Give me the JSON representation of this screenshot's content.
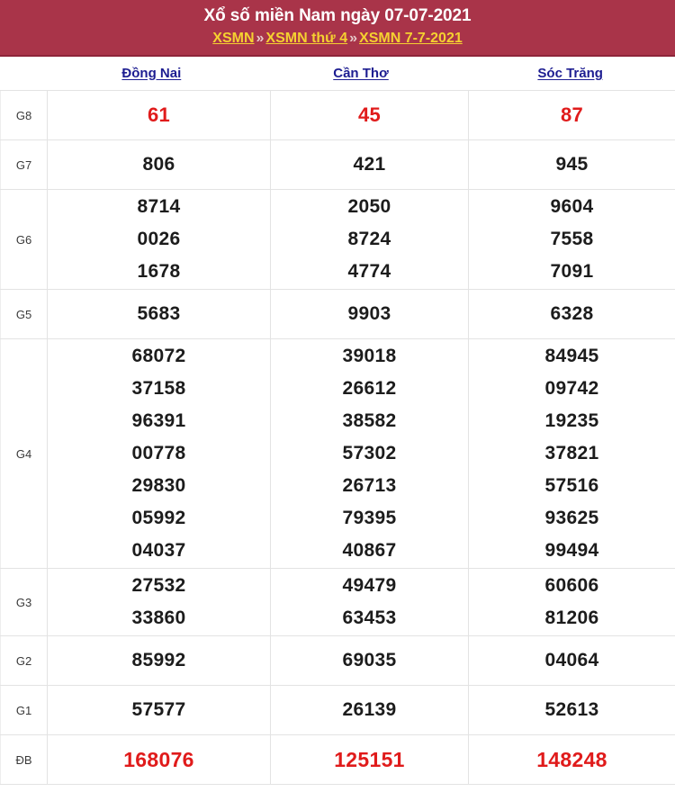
{
  "banner": {
    "title": "Xổ số miền Nam ngày 07-07-2021",
    "breadcrumb": {
      "items": [
        "XSMN",
        "XSMN thứ 4",
        "XSMN 7-7-2021"
      ],
      "separator": "»"
    },
    "bg_color": "#a93449",
    "title_color": "#ffffff",
    "link_color": "#f5d130"
  },
  "table": {
    "provinces": [
      "Đồng Nai",
      "Cần Thơ",
      "Sóc Trăng"
    ],
    "province_link_color": "#1d1d91",
    "highlight_color": "#e01b1b",
    "rows": [
      {
        "prize": "G8",
        "highlight": true,
        "values": [
          [
            "61"
          ],
          [
            "45"
          ],
          [
            "87"
          ]
        ]
      },
      {
        "prize": "G7",
        "highlight": false,
        "values": [
          [
            "806"
          ],
          [
            "421"
          ],
          [
            "945"
          ]
        ]
      },
      {
        "prize": "G6",
        "highlight": false,
        "values": [
          [
            "8714",
            "0026",
            "1678"
          ],
          [
            "2050",
            "8724",
            "4774"
          ],
          [
            "9604",
            "7558",
            "7091"
          ]
        ]
      },
      {
        "prize": "G5",
        "highlight": false,
        "values": [
          [
            "5683"
          ],
          [
            "9903"
          ],
          [
            "6328"
          ]
        ]
      },
      {
        "prize": "G4",
        "highlight": false,
        "values": [
          [
            "68072",
            "37158",
            "96391",
            "00778",
            "29830",
            "05992",
            "04037"
          ],
          [
            "39018",
            "26612",
            "38582",
            "57302",
            "26713",
            "79395",
            "40867"
          ],
          [
            "84945",
            "09742",
            "19235",
            "37821",
            "57516",
            "93625",
            "99494"
          ]
        ]
      },
      {
        "prize": "G3",
        "highlight": false,
        "values": [
          [
            "27532",
            "33860"
          ],
          [
            "49479",
            "63453"
          ],
          [
            "60606",
            "81206"
          ]
        ]
      },
      {
        "prize": "G2",
        "highlight": false,
        "values": [
          [
            "85992"
          ],
          [
            "69035"
          ],
          [
            "04064"
          ]
        ]
      },
      {
        "prize": "G1",
        "highlight": false,
        "values": [
          [
            "57577"
          ],
          [
            "26139"
          ],
          [
            "52613"
          ]
        ]
      },
      {
        "prize": "ĐB",
        "highlight": true,
        "values": [
          [
            "168076"
          ],
          [
            "125151"
          ],
          [
            "148248"
          ]
        ]
      }
    ]
  }
}
